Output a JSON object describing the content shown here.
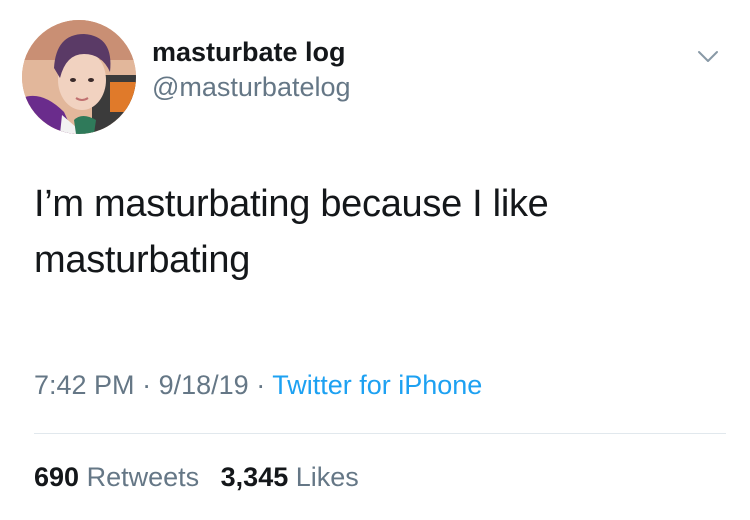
{
  "user": {
    "display_name": "masturbate log",
    "handle": "@masturbatelog",
    "avatar_icon": "profile-photo-icon"
  },
  "menu": {
    "icon": "chevron-down-icon"
  },
  "tweet": {
    "text": "I’m masturbating because I like masturbating",
    "time": "7:42 PM",
    "separator": "·",
    "date": "9/18/19",
    "source": "Twitter for iPhone"
  },
  "stats": {
    "retweets_count": "690",
    "retweets_label": "Retweets",
    "likes_count": "3,345",
    "likes_label": "Likes"
  },
  "colors": {
    "text": "#14171a",
    "secondary": "#657786",
    "link": "#1da1f2",
    "divider": "#e1e8ed"
  }
}
